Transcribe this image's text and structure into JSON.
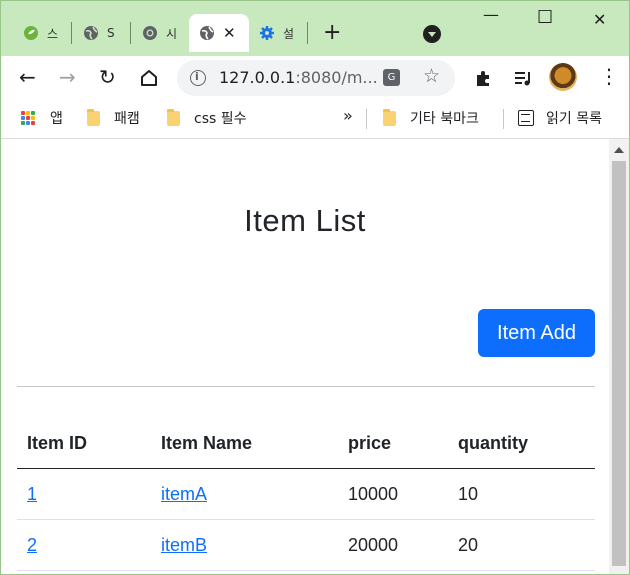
{
  "browser": {
    "tabs": [
      {
        "title": "스",
        "icon": "spring-icon",
        "active": false
      },
      {
        "title": "S",
        "icon": "globe-icon",
        "active": false
      },
      {
        "title": "시",
        "icon": "chrome-icon",
        "active": false
      },
      {
        "title": "",
        "icon": "globe-icon",
        "active": true
      },
      {
        "title": "설",
        "icon": "gear-icon",
        "active": false
      }
    ],
    "new_tab_label": "+",
    "window_controls": {
      "minimize": "—",
      "maximize": "☐",
      "close": "✕"
    },
    "url_host": "127.0.0.1",
    "url_rest": ":8080/m...",
    "translate_label": "G",
    "bookmarks": [
      {
        "label": "앱",
        "icon": "apps-grid-icon"
      },
      {
        "label": "패캠",
        "icon": "folder-icon"
      },
      {
        "label": "css 필수",
        "icon": "folder-icon"
      }
    ],
    "bookmarks_overflow": "»",
    "other_bookmarks": "기타 북마크",
    "reading_list": "읽기 목록",
    "colors": {
      "tabstrip": "#c7e9bd",
      "accent": "#0d6efd"
    }
  },
  "page": {
    "title": "Item List",
    "add_button": "Item Add",
    "table": {
      "headers": [
        "Item ID",
        "Item Name",
        "price",
        "quantity"
      ],
      "rows": [
        {
          "id": "1",
          "name": "itemA",
          "price": "10000",
          "quantity": "10"
        },
        {
          "id": "2",
          "name": "itemB",
          "price": "20000",
          "quantity": "20"
        }
      ]
    }
  }
}
